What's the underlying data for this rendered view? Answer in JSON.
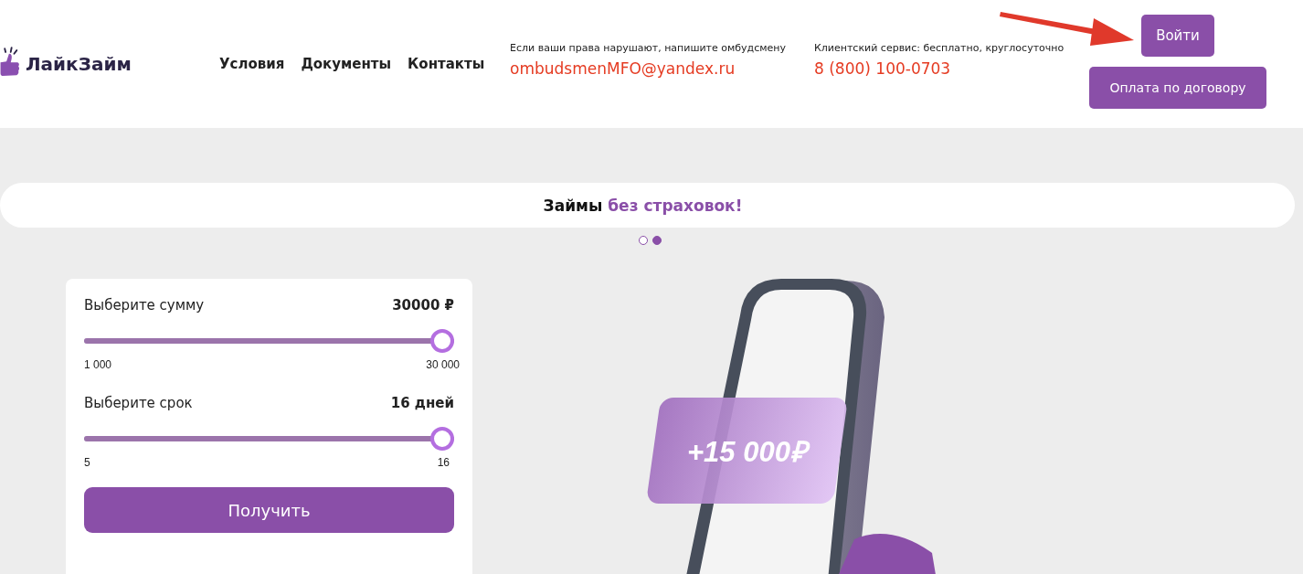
{
  "header": {
    "logo": "ЛайкЗайм",
    "nav": [
      {
        "label": "Условия"
      },
      {
        "label": "Документы"
      },
      {
        "label": "Контакты"
      }
    ],
    "contacts": [
      {
        "caption": "Если ваши права нарушают, напишите омбудсмену",
        "value": "ombudsmenMFO@yandex.ru"
      },
      {
        "caption": "Клиентский сервис: бесплатно, круглосуточно",
        "value": "8 (800) 100-0703"
      }
    ],
    "login_button": "Войти",
    "payment_button": "Оплата по договору"
  },
  "banner": {
    "lead": "Займы",
    "highlight": "без страховок!"
  },
  "carousel_dots": [
    {
      "selected": false
    },
    {
      "selected": true
    }
  ],
  "calculator": {
    "sliders": [
      {
        "label": "Выберите сумму",
        "value": "30000 ₽",
        "level": 1,
        "min": "1 000",
        "max": "30 000"
      },
      {
        "label": "Выберите срок",
        "value": "16 дней",
        "level": 1,
        "min": "5",
        "max": "16"
      }
    ],
    "submit": "Получить"
  },
  "illustration": {
    "card_text": "+15 000₽"
  }
}
